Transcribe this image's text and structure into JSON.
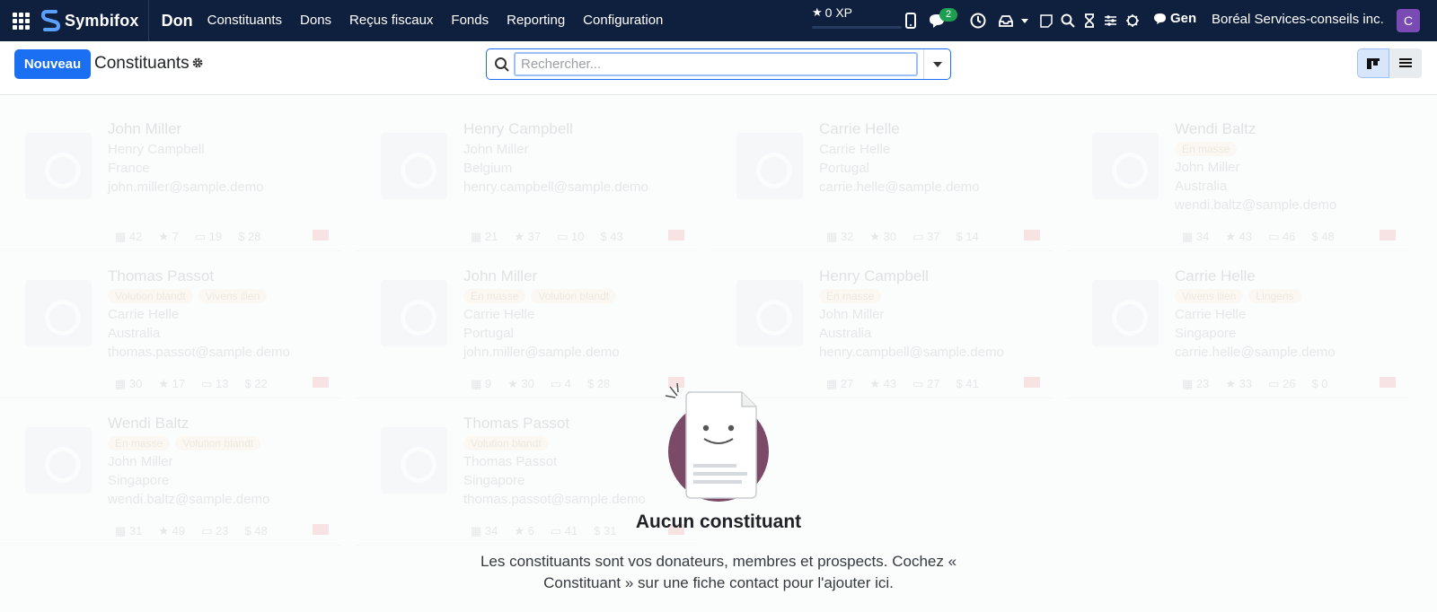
{
  "navbar": {
    "brand": "Symbifox",
    "app_name": "Don",
    "menu": [
      "Constituants",
      "Dons",
      "Reçus fiscaux",
      "Fonds",
      "Reporting",
      "Configuration"
    ],
    "xp_label": "0 XP",
    "chat_badge": "2",
    "user_short": "Gen",
    "company": "Boréal Services-conseils inc.",
    "avatar_letter": "C"
  },
  "control": {
    "new_button": "Nouveau",
    "title": "Constituants",
    "search_placeholder": "Rechercher..."
  },
  "sample_cards": [
    {
      "name": "John Miller",
      "lines": [
        "Henry Campbell",
        "France",
        "john.miller@sample.demo"
      ],
      "tags": [],
      "stats": [
        "42",
        "7",
        "19",
        "28"
      ]
    },
    {
      "name": "Henry Campbell",
      "lines": [
        "John Miller",
        "Belgium",
        "henry.campbell@sample.demo"
      ],
      "tags": [],
      "stats": [
        "21",
        "37",
        "10",
        "43"
      ]
    },
    {
      "name": "Carrie Helle",
      "lines": [
        "Carrie Helle",
        "Portugal",
        "carrie.helle@sample.demo"
      ],
      "tags": [],
      "stats": [
        "32",
        "30",
        "37",
        "14"
      ]
    },
    {
      "name": "Wendi Baltz",
      "lines": [
        "John Miller",
        "Australia",
        "wendi.baltz@sample.demo"
      ],
      "tags": [
        "En masse"
      ],
      "stats": [
        "34",
        "43",
        "46",
        "48"
      ]
    },
    {
      "name": "Thomas Passot",
      "lines": [
        "Carrie Helle",
        "Australia",
        "thomas.passot@sample.demo"
      ],
      "tags": [
        "Volution blandt",
        "Vivens ilien"
      ],
      "stats": [
        "30",
        "17",
        "13",
        "22"
      ]
    },
    {
      "name": "John Miller",
      "lines": [
        "Carrie Helle",
        "Portugal",
        "john.miller@sample.demo"
      ],
      "tags": [
        "En masse",
        "Volution blandt"
      ],
      "stats": [
        "9",
        "30",
        "4",
        "28"
      ]
    },
    {
      "name": "Henry Campbell",
      "lines": [
        "John Miller",
        "Australia",
        "henry.campbell@sample.demo"
      ],
      "tags": [
        "En masse"
      ],
      "stats": [
        "27",
        "43",
        "27",
        "41"
      ]
    },
    {
      "name": "Carrie Helle",
      "lines": [
        "Carrie Helle",
        "Singapore",
        "carrie.helle@sample.demo"
      ],
      "tags": [
        "Vivens ilien",
        "Lingens"
      ],
      "stats": [
        "23",
        "33",
        "26",
        "0"
      ]
    },
    {
      "name": "Wendi Baltz",
      "lines": [
        "John Miller",
        "Singapore",
        "wendi.baltz@sample.demo"
      ],
      "tags": [
        "En masse",
        "Volution blandt"
      ],
      "stats": [
        "31",
        "49",
        "23",
        "48"
      ]
    },
    {
      "name": "Thomas Passot",
      "lines": [
        "Thomas Passot",
        "Singapore",
        "thomas.passot@sample.demo"
      ],
      "tags": [
        "Volution blandt"
      ],
      "stats": [
        "34",
        "6",
        "41",
        "31"
      ]
    }
  ],
  "empty_state": {
    "title": "Aucun constituant",
    "description": "Les constituants sont vos donateurs, membres et prospects. Cochez « Constituant » sur une fiche contact pour l'ajouter ici."
  },
  "colors": {
    "navbar_bg": "#0f1f3e",
    "primary": "#1a6ff2",
    "badge": "#1e9e50",
    "avatar": "#7b4bb5"
  }
}
